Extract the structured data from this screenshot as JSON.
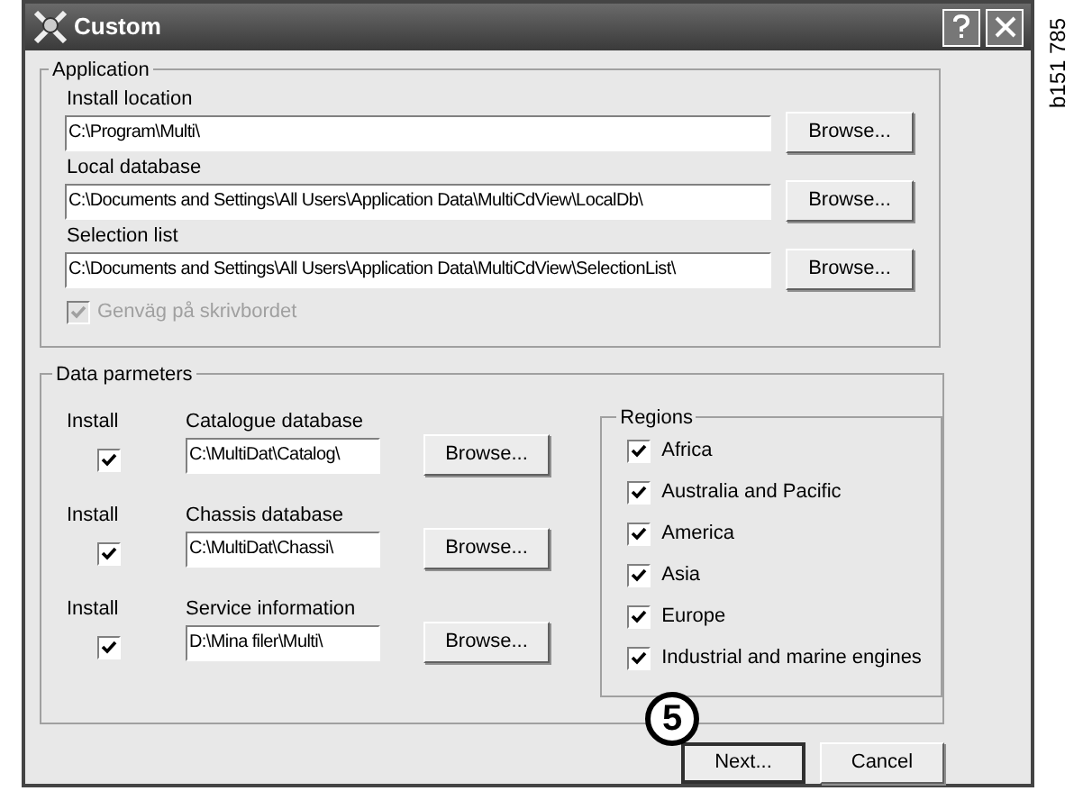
{
  "window": {
    "title": "Custom"
  },
  "side_label": "b151 785",
  "callout": "5",
  "application": {
    "title": "Application",
    "fields": [
      {
        "label": "Install location",
        "value": "C:\\Program\\Multi\\",
        "button": "Browse..."
      },
      {
        "label": "Local database",
        "value": "C:\\Documents and Settings\\All Users\\Application Data\\MultiCdView\\LocalDb\\",
        "button": "Browse..."
      },
      {
        "label": "Selection list",
        "value": "C:\\Documents and Settings\\All Users\\Application Data\\MultiCdView\\SelectionList\\",
        "button": "Browse..."
      }
    ],
    "shortcut": {
      "label": "Genväg på skrivbordet",
      "checked": true,
      "disabled": true
    }
  },
  "data_parameters": {
    "title": "Data parmeters",
    "rows": [
      {
        "install_label": "Install",
        "install": true,
        "label": "Catalogue database",
        "value": "C:\\MultiDat\\Catalog\\",
        "button": "Browse..."
      },
      {
        "install_label": "Install",
        "install": true,
        "label": "Chassis database",
        "value": "C:\\MultiDat\\Chassi\\",
        "button": "Browse..."
      },
      {
        "install_label": "Install",
        "install": true,
        "label": "Service information",
        "value": "D:\\Mina filer\\Multi\\",
        "button": "Browse..."
      }
    ],
    "regions": {
      "title": "Regions",
      "items": [
        {
          "label": "Africa",
          "checked": true
        },
        {
          "label": "Australia and Pacific",
          "checked": true
        },
        {
          "label": "America",
          "checked": true
        },
        {
          "label": "Asia",
          "checked": true
        },
        {
          "label": "Europe",
          "checked": true
        },
        {
          "label": "Industrial and marine engines",
          "checked": true
        }
      ]
    }
  },
  "buttons": [
    {
      "label": "Next...",
      "default": true
    },
    {
      "label": "Cancel",
      "default": false
    }
  ]
}
